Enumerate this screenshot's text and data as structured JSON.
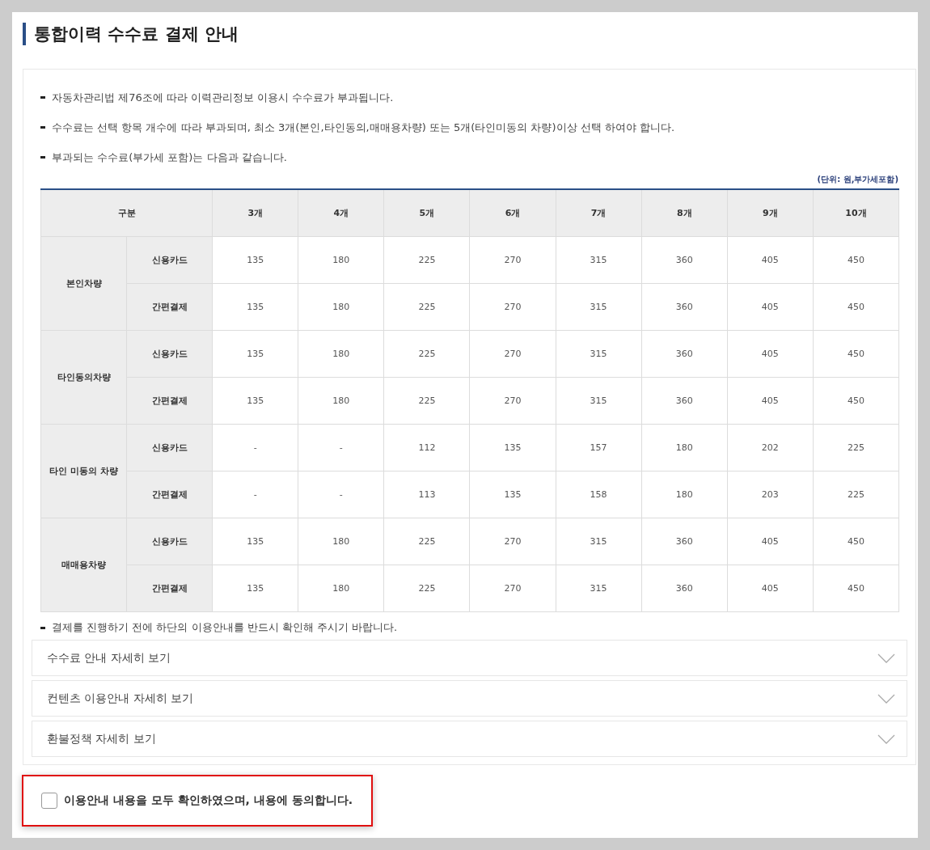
{
  "title": "통합이력 수수료 결제 안내",
  "notices": [
    "자동차관리법 제76조에 따라 이력관리정보 이용시 수수료가 부과됩니다.",
    "수수료는 선택 항목 개수에 따라 부과되며, 최소 3개(본인,타인동의,매매용차량) 또는 5개(타인미동의 차량)이상 선택 하여야 합니다.",
    "부과되는 수수료(부가세 포함)는 다음과 같습니다."
  ],
  "unit_note": "(단위: 원,부가세포함)",
  "table": {
    "header": "구분",
    "columns": [
      "3개",
      "4개",
      "5개",
      "6개",
      "7개",
      "8개",
      "9개",
      "10개"
    ],
    "groups": [
      {
        "label": "본인차량",
        "rows": [
          {
            "type": "신용카드",
            "values": [
              "135",
              "180",
              "225",
              "270",
              "315",
              "360",
              "405",
              "450"
            ]
          },
          {
            "type": "간편결제",
            "values": [
              "135",
              "180",
              "225",
              "270",
              "315",
              "360",
              "405",
              "450"
            ]
          }
        ]
      },
      {
        "label": "타인동의차량",
        "rows": [
          {
            "type": "신용카드",
            "values": [
              "135",
              "180",
              "225",
              "270",
              "315",
              "360",
              "405",
              "450"
            ]
          },
          {
            "type": "간편결제",
            "values": [
              "135",
              "180",
              "225",
              "270",
              "315",
              "360",
              "405",
              "450"
            ]
          }
        ]
      },
      {
        "label": "타인 미동의 차량",
        "rows": [
          {
            "type": "신용카드",
            "values": [
              "-",
              "-",
              "112",
              "135",
              "157",
              "180",
              "202",
              "225"
            ]
          },
          {
            "type": "간편결제",
            "values": [
              "-",
              "-",
              "113",
              "135",
              "158",
              "180",
              "203",
              "225"
            ]
          }
        ]
      },
      {
        "label": "매매용차량",
        "rows": [
          {
            "type": "신용카드",
            "values": [
              "135",
              "180",
              "225",
              "270",
              "315",
              "360",
              "405",
              "450"
            ]
          },
          {
            "type": "간편결제",
            "values": [
              "135",
              "180",
              "225",
              "270",
              "315",
              "360",
              "405",
              "450"
            ]
          }
        ]
      }
    ]
  },
  "payment_notice": "결제를 진행하기 전에 하단의 이용안내를 반드시 확인해 주시기 바랍니다.",
  "accordions": [
    {
      "label": "수수료 안내 자세히 보기",
      "expanded": false
    },
    {
      "label": "컨텐츠 이용안내 자세히 보기",
      "expanded": false
    },
    {
      "label": "환불정책 자세히 보기",
      "expanded": false
    }
  ],
  "agreement": {
    "label": "이용안내 내용을 모두 확인하였으며, 내용에 동의합니다.",
    "checked": false
  }
}
